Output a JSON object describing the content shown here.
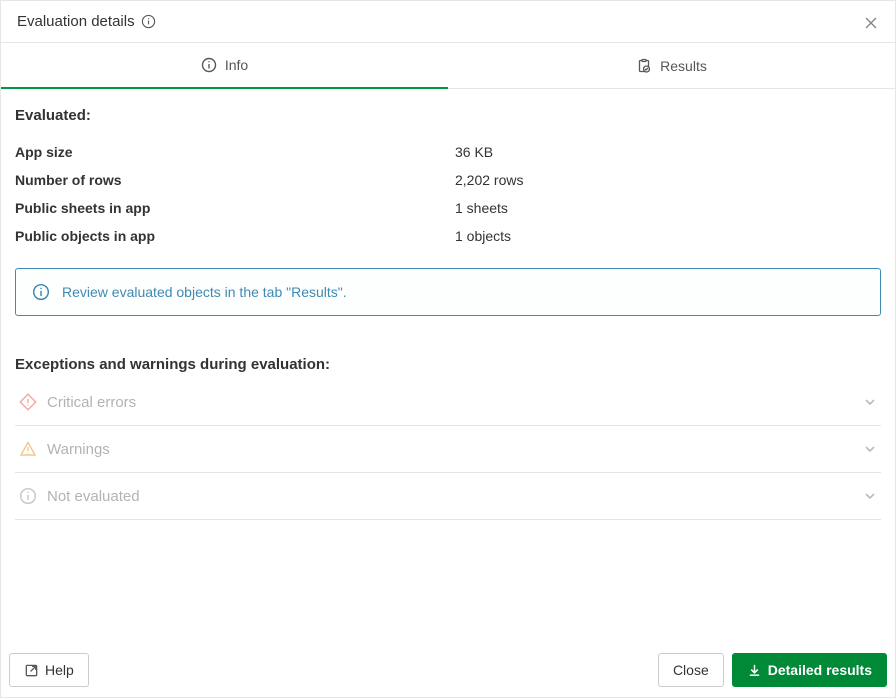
{
  "header": {
    "title": "Evaluation details"
  },
  "tabs": {
    "info": "Info",
    "results": "Results"
  },
  "evaluated": {
    "heading": "Evaluated:",
    "rows": [
      {
        "label": "App size",
        "value": "36 KB"
      },
      {
        "label": "Number of rows",
        "value": "2,202 rows"
      },
      {
        "label": "Public sheets in app",
        "value": "1 sheets"
      },
      {
        "label": "Public objects in app",
        "value": "1 objects"
      }
    ]
  },
  "banner": {
    "text": "Review evaluated objects in the tab \"Results\"."
  },
  "exceptions": {
    "heading": "Exceptions and warnings during evaluation:",
    "critical": "Critical errors",
    "warnings": "Warnings",
    "not_evaluated": "Not evaluated"
  },
  "footer": {
    "help": "Help",
    "close": "Close",
    "detailed": "Detailed results"
  }
}
